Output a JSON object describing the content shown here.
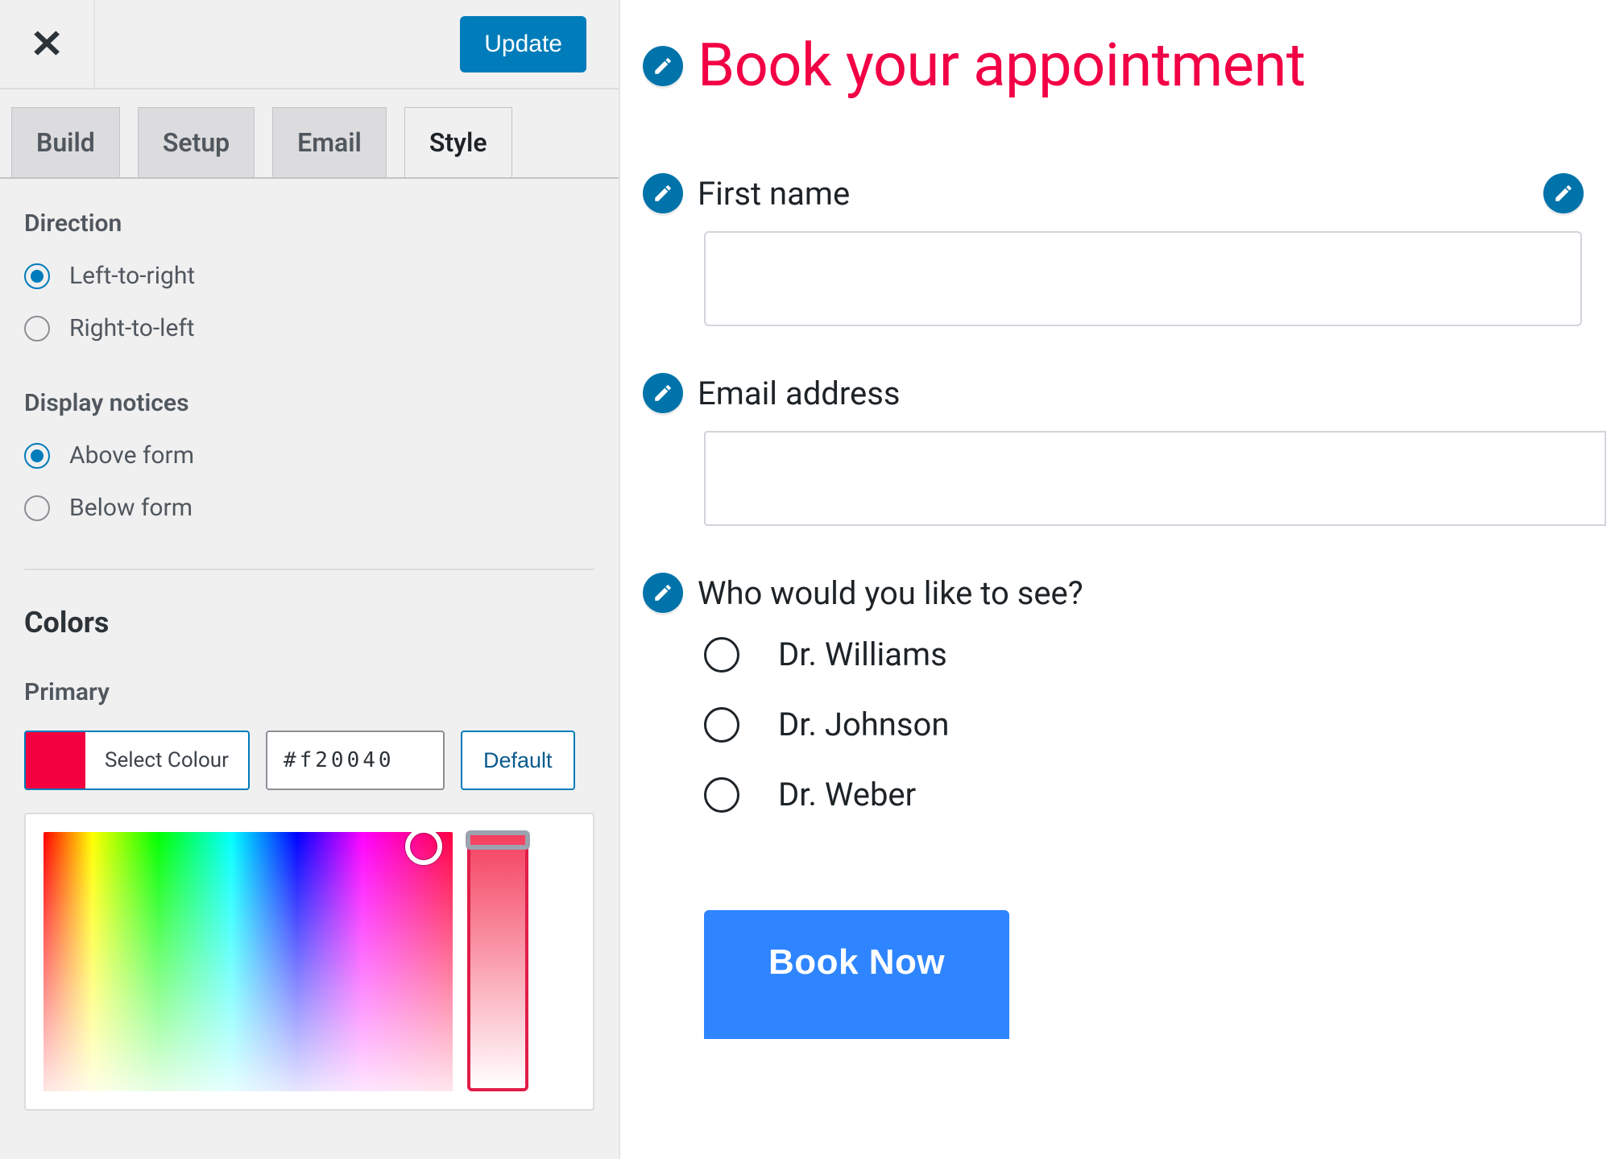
{
  "topbar": {
    "update_label": "Update"
  },
  "tabs": [
    {
      "label": "Build"
    },
    {
      "label": "Setup"
    },
    {
      "label": "Email"
    },
    {
      "label": "Style"
    }
  ],
  "panel": {
    "direction_heading": "Direction",
    "direction_options": [
      {
        "label": "Left-to-right",
        "checked": true
      },
      {
        "label": "Right-to-left",
        "checked": false
      }
    ],
    "notices_heading": "Display notices",
    "notices_options": [
      {
        "label": "Above form",
        "checked": true
      },
      {
        "label": "Below form",
        "checked": false
      }
    ],
    "colors_heading": "Colors",
    "primary_label": "Primary",
    "select_colour_label": "Select Colour",
    "hex_value": "#f20040",
    "default_label": "Default",
    "primary_color": "#f20040"
  },
  "form": {
    "title": "Book your appointment",
    "first_name_label": "First name",
    "email_label": "Email address",
    "question_label": "Who would you like to see?",
    "options": [
      {
        "label": "Dr. Williams"
      },
      {
        "label": "Dr. Johnson"
      },
      {
        "label": "Dr. Weber"
      }
    ],
    "submit_label": "Book Now"
  }
}
